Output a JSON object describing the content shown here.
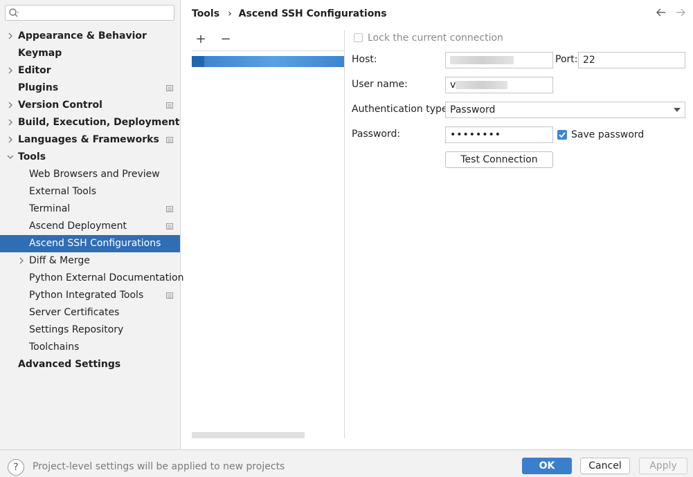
{
  "search": {
    "placeholder": ""
  },
  "breadcrumb": {
    "parent": "Tools",
    "separator": "›",
    "current": "Ascend SSH Configurations"
  },
  "sidebar": {
    "items": [
      {
        "label": "Appearance & Behavior",
        "level": "top",
        "chevron": "right",
        "badge": false
      },
      {
        "label": "Keymap",
        "level": "top",
        "chevron": "none",
        "badge": false
      },
      {
        "label": "Editor",
        "level": "top",
        "chevron": "right",
        "badge": false
      },
      {
        "label": "Plugins",
        "level": "top",
        "chevron": "none",
        "badge": true
      },
      {
        "label": "Version Control",
        "level": "top",
        "chevron": "right",
        "badge": true
      },
      {
        "label": "Build, Execution, Deployment",
        "level": "top",
        "chevron": "right",
        "badge": false
      },
      {
        "label": "Languages & Frameworks",
        "level": "top",
        "chevron": "right",
        "badge": true
      },
      {
        "label": "Tools",
        "level": "top",
        "chevron": "down",
        "badge": false
      },
      {
        "label": "Web Browsers and Preview",
        "level": "sub",
        "chevron": "none",
        "badge": false
      },
      {
        "label": "External Tools",
        "level": "sub",
        "chevron": "none",
        "badge": false
      },
      {
        "label": "Terminal",
        "level": "sub",
        "chevron": "none",
        "badge": true
      },
      {
        "label": "Ascend Deployment",
        "level": "sub",
        "chevron": "none",
        "badge": true
      },
      {
        "label": "Ascend SSH Configurations",
        "level": "sub",
        "chevron": "none",
        "badge": false,
        "selected": true
      },
      {
        "label": "Diff & Merge",
        "level": "sub",
        "chevron": "right",
        "badge": false
      },
      {
        "label": "Python External Documentation",
        "level": "sub",
        "chevron": "none",
        "badge": false
      },
      {
        "label": "Python Integrated Tools",
        "level": "sub",
        "chevron": "none",
        "badge": true
      },
      {
        "label": "Server Certificates",
        "level": "sub",
        "chevron": "none",
        "badge": false
      },
      {
        "label": "Settings Repository",
        "level": "sub",
        "chevron": "none",
        "badge": false
      },
      {
        "label": "Toolchains",
        "level": "sub",
        "chevron": "none",
        "badge": false
      },
      {
        "label": "Advanced Settings",
        "level": "top",
        "chevron": "none",
        "badge": false
      }
    ]
  },
  "toolbar": {
    "add": "+",
    "remove": "−"
  },
  "form": {
    "lock_label": "Lock the current connection",
    "host_label": "Host:",
    "host_value": "",
    "port_label": "Port:",
    "port_value": "22",
    "user_label": "User name:",
    "user_value_prefix": "v",
    "auth_label": "Authentication type:",
    "auth_value": "Password",
    "password_label": "Password:",
    "password_value": "••••••••",
    "save_password_label": "Save password",
    "save_password_checked": true,
    "test_button": "Test Connection"
  },
  "footer": {
    "help": "?",
    "message": "Project-level settings will be applied to new projects",
    "ok": "OK",
    "cancel": "Cancel",
    "apply": "Apply"
  },
  "colors": {
    "accent": "#2f6db5",
    "ok_button": "#3a7fcb",
    "sidebar_bg": "#f2f2f2"
  }
}
